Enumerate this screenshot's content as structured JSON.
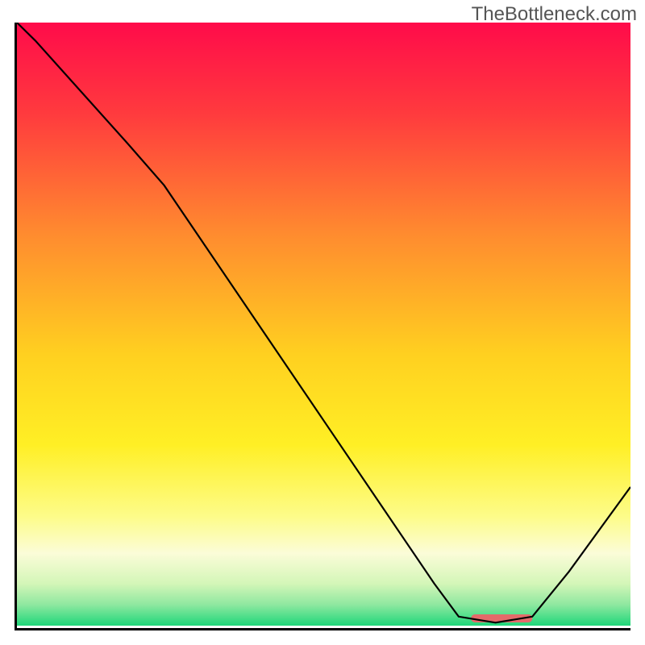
{
  "watermark": "TheBottleneck.com",
  "chart_data": {
    "type": "line",
    "title": "",
    "xlabel": "",
    "ylabel": "",
    "xlim": [
      0,
      100
    ],
    "ylim": [
      0,
      100
    ],
    "background_gradient": {
      "stops": [
        {
          "offset": 0,
          "color": "#ff0b4a"
        },
        {
          "offset": 0.15,
          "color": "#ff3a3e"
        },
        {
          "offset": 0.35,
          "color": "#ff8b2f"
        },
        {
          "offset": 0.55,
          "color": "#ffd020"
        },
        {
          "offset": 0.7,
          "color": "#ffef25"
        },
        {
          "offset": 0.82,
          "color": "#fdfc8a"
        },
        {
          "offset": 0.88,
          "color": "#fbfcd8"
        },
        {
          "offset": 0.93,
          "color": "#d4f6b8"
        },
        {
          "offset": 0.965,
          "color": "#8fe8a0"
        },
        {
          "offset": 1.0,
          "color": "#1fd77a"
        }
      ]
    },
    "series": [
      {
        "name": "curve",
        "color": "#000000",
        "points": [
          {
            "x": 0,
            "y": 100
          },
          {
            "x": 3,
            "y": 97
          },
          {
            "x": 18,
            "y": 80
          },
          {
            "x": 24,
            "y": 73
          },
          {
            "x": 30,
            "y": 64
          },
          {
            "x": 40,
            "y": 49
          },
          {
            "x": 50,
            "y": 34
          },
          {
            "x": 60,
            "y": 19
          },
          {
            "x": 68,
            "y": 7
          },
          {
            "x": 72,
            "y": 1.5
          },
          {
            "x": 78,
            "y": 0.5
          },
          {
            "x": 84,
            "y": 1.5
          },
          {
            "x": 90,
            "y": 9
          },
          {
            "x": 100,
            "y": 23
          }
        ]
      }
    ],
    "marker": {
      "name": "optimum-bar",
      "color": "#e46a6a",
      "x_start": 74,
      "x_end": 84,
      "y": 1.2,
      "thickness": 10,
      "radius": 5
    }
  }
}
